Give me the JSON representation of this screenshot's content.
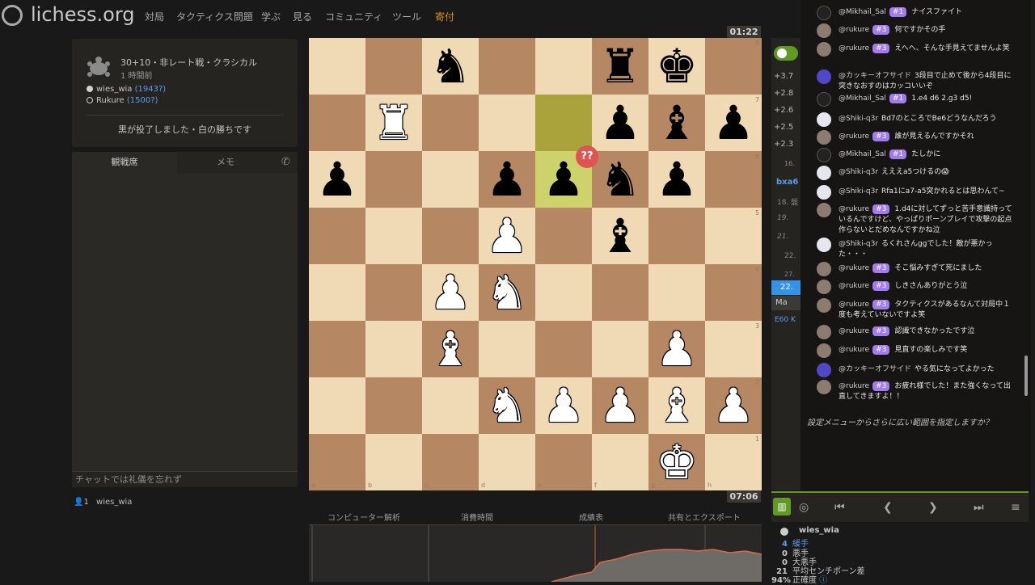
{
  "header": {
    "logo": "lichess.org",
    "nav": [
      "対局",
      "タクティクス問題",
      "学ぶ",
      "見る",
      "コミュニティ",
      "ツール",
      "寄付"
    ]
  },
  "game": {
    "title": "30+10・非レート戦・クラシカル",
    "time_ago": "1 時間前",
    "white_player": "wies_wia",
    "white_rating": "(1943?)",
    "black_player": "Rukure",
    "black_rating": "(1500?)",
    "result": "黒が投了しました・白の勝ちです"
  },
  "left_chat": {
    "tab_spectators": "観戦席",
    "tab_notes": "メモ",
    "input_placeholder": "チャットでは礼儀を忘れず",
    "spectator_count": "1",
    "spectator_name": "wies_wia"
  },
  "board": {
    "clock_top": "01:22",
    "clock_bottom": "07:06",
    "annotation": "??",
    "files": [
      "a",
      "b",
      "c",
      "d",
      "e",
      "f",
      "g",
      "h"
    ],
    "ranks": [
      "8",
      "7",
      "6",
      "5",
      "4",
      "3",
      "2",
      "1"
    ],
    "pieces": [
      {
        "sq": "c8",
        "p": "n"
      },
      {
        "sq": "f8",
        "p": "r"
      },
      {
        "sq": "g8",
        "p": "k"
      },
      {
        "sq": "b7",
        "p": "R"
      },
      {
        "sq": "f7",
        "p": "p"
      },
      {
        "sq": "g7",
        "p": "b"
      },
      {
        "sq": "h7",
        "p": "p"
      },
      {
        "sq": "a6",
        "p": "p"
      },
      {
        "sq": "d6",
        "p": "p"
      },
      {
        "sq": "e6",
        "p": "p"
      },
      {
        "sq": "f6",
        "p": "n"
      },
      {
        "sq": "g6",
        "p": "p"
      },
      {
        "sq": "d5",
        "p": "P"
      },
      {
        "sq": "f5",
        "p": "b"
      },
      {
        "sq": "c4",
        "p": "P"
      },
      {
        "sq": "d4",
        "p": "N"
      },
      {
        "sq": "c3",
        "p": "B"
      },
      {
        "sq": "g3",
        "p": "P"
      },
      {
        "sq": "d2",
        "p": "N"
      },
      {
        "sq": "e2",
        "p": "P"
      },
      {
        "sq": "f2",
        "p": "P"
      },
      {
        "sq": "g2",
        "p": "B"
      },
      {
        "sq": "h2",
        "p": "P"
      },
      {
        "sq": "g1",
        "p": "K"
      }
    ],
    "highlights": [
      "e7",
      "e6"
    ]
  },
  "bottom_tabs": [
    "コンピューター解析",
    "消費時間",
    "成績表",
    "共有とエクスポート"
  ],
  "evals": [
    "+3.7",
    "+2.8",
    "+2.6",
    "+2.5",
    "+2.3"
  ],
  "move_fragments": [
    "16.",
    "bxa6",
    "18. 盤",
    "19.",
    "21.",
    "22.",
    "27.",
    "22.",
    "Ma",
    "E60 K"
  ],
  "chat": [
    {
      "user": "@Mikhail_Sal",
      "badge": "#1",
      "text": "ナイスファイト",
      "avatar": "dark"
    },
    {
      "user": "@rukure",
      "badge": "#3",
      "text": "何ですかその手",
      "avatar": "cat"
    },
    {
      "user": "@rukure",
      "badge": "#3",
      "text": "えへへ、そんな手見えてませんよ笑",
      "avatar": "cat"
    },
    {
      "user": "@カッキーオフサイド",
      "badge": "",
      "text": "3段目で止めて後から4段目に突きなおすのはカッコいいぞ",
      "avatar": "purple"
    },
    {
      "user": "@Mikhail_Sal",
      "badge": "#1",
      "text": "1.e4 d6 2.g3 d5!",
      "avatar": "dark"
    },
    {
      "user": "@Shiki-q3r",
      "badge": "",
      "text": "Bd7のところでBe6どうなんだろう",
      "avatar": "white"
    },
    {
      "user": "@rukure",
      "badge": "#3",
      "text": "誰が見えるんですかそれ",
      "avatar": "cat"
    },
    {
      "user": "@Mikhail_Sal",
      "badge": "#1",
      "text": "たしかに",
      "avatar": "dark"
    },
    {
      "user": "@Shiki-q3r",
      "badge": "",
      "text": "えええa5つけるの😱",
      "avatar": "white"
    },
    {
      "user": "@Shiki-q3r",
      "badge": "",
      "text": "Rfa1にa7-a5突かれるとは思わんて~",
      "avatar": "white"
    },
    {
      "user": "@rukure",
      "badge": "#3",
      "text": "1.d4に対してずっと苦手意識持っているんですけど、やっぱりポーンプレイで攻撃の起点作らないとだめなんですかね泣",
      "avatar": "cat"
    },
    {
      "user": "@Shiki-q3r",
      "badge": "",
      "text": "るくれさんggでした！敵が悪かった・・・",
      "avatar": "white"
    },
    {
      "user": "@rukure",
      "badge": "#3",
      "text": "そこ悩みすぎて死にました",
      "avatar": "cat"
    },
    {
      "user": "@rukure",
      "badge": "#3",
      "text": "しきさんありがとう泣",
      "avatar": "cat"
    },
    {
      "user": "@rukure",
      "badge": "#3",
      "text": "タクティクスがあるなんて対局中１度も考えていないですよ笑",
      "avatar": "cat"
    },
    {
      "user": "@rukure",
      "badge": "#3",
      "text": "認識できなかったです泣",
      "avatar": "cat"
    },
    {
      "user": "@rukure",
      "badge": "#3",
      "text": "見直すの楽しみです笑",
      "avatar": "cat"
    },
    {
      "user": "@カッキーオフサイド",
      "badge": "",
      "text": "やる気になってよかった",
      "avatar": "purple"
    },
    {
      "user": "@rukure",
      "badge": "#3",
      "text": "お疲れ様でした！また強くなって出直してきますよ！！",
      "avatar": "cat"
    }
  ],
  "hint": "設定メニューからさらに広い範囲を指定しますか？",
  "stats": {
    "player": "wies_wia",
    "rows": [
      {
        "n": "4",
        "label": "緩手"
      },
      {
        "n": "0",
        "label": "悪手"
      },
      {
        "n": "0",
        "label": "大悪手"
      },
      {
        "n": "21",
        "label": "平均センチポーン差"
      },
      {
        "n": "94%",
        "label": "正確度"
      }
    ]
  },
  "colors": {
    "board_light": "#f0d9b5",
    "board_dark": "#b58863",
    "accent_green": "#629924",
    "badge_purple": "#a07cf0",
    "donate_orange": "#d59020"
  }
}
